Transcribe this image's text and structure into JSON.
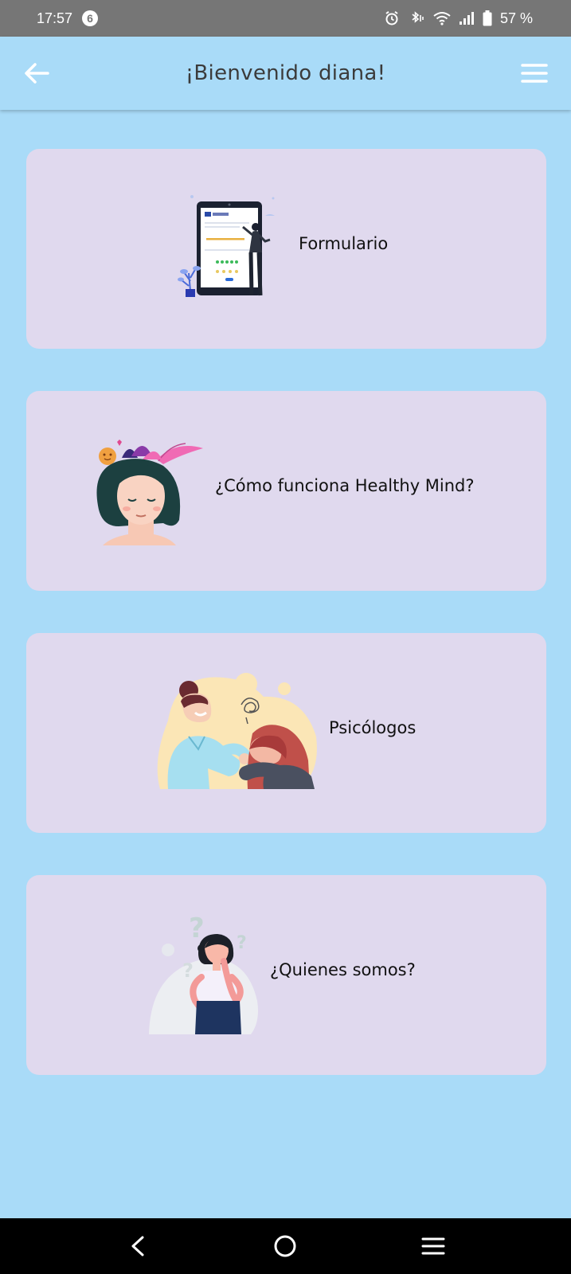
{
  "status_bar": {
    "time": "17:57",
    "notification_count": "6",
    "battery": "57 %"
  },
  "app_bar": {
    "title": "¡Bienvenido diana!"
  },
  "cards": [
    {
      "label": "Formulario",
      "illustration": "tablet-form-illustration"
    },
    {
      "label": "¿Cómo funciona Healthy Mind?",
      "illustration": "calm-woman-illustration"
    },
    {
      "label": "Psicólogos",
      "illustration": "psychologist-support-illustration"
    },
    {
      "label": "¿Quienes somos?",
      "illustration": "thinking-woman-illustration"
    }
  ],
  "colors": {
    "background": "#a9dbf8",
    "card": "#e0d9ee",
    "status_bar": "#767676",
    "nav_bar": "#000000"
  },
  "icons": {
    "back": "arrow-left-icon",
    "menu": "hamburger-menu-icon",
    "nav_back": "chevron-left-icon",
    "nav_home": "circle-home-icon",
    "nav_recents": "hamburger-recents-icon"
  }
}
